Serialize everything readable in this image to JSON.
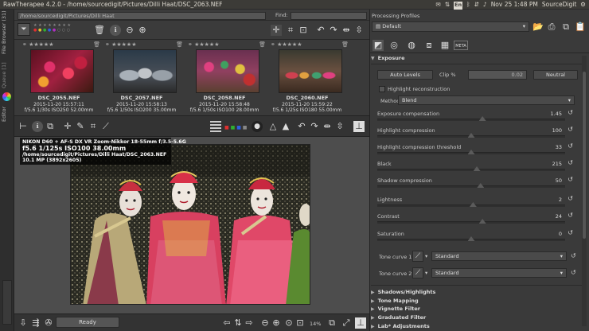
{
  "system_bar": {
    "window_title": "RawTherapee 4.2.0 - /home/sourcedigit/Pictures/Dilli Haat/DSC_2063.NEF",
    "keyboard": "En",
    "datetime": "Nov 25  1:48 PM",
    "user": "SourceDigit"
  },
  "side_tabs": {
    "file_browser": "File Browser (31)",
    "queue": "Queue [1]",
    "editor": "Editor"
  },
  "browser": {
    "path": "/home/sourcedigit/Pictures/Dilli Haat",
    "find_label": "Find:",
    "find_value": "",
    "thumbnails": [
      {
        "filename": "DSC_2055.NEF",
        "date": "2015-11-20 15:57:11",
        "exif": "f/5.6 1/30s ISO250 52.00mm",
        "stars": "★★★★★"
      },
      {
        "filename": "DSC_2057.NEF",
        "date": "2015-11-20 15:58:13",
        "exif": "f/5.6 1/50s ISO200 35.00mm",
        "stars": "★★★★★"
      },
      {
        "filename": "DSC_2058.NEF",
        "date": "2015-11-20 15:58:48",
        "exif": "f/5.6 1/50s ISO100 28.00mm",
        "stars": "★★★★★"
      },
      {
        "filename": "DSC_2060.NEF",
        "date": "2015-11-20 15:59:22",
        "exif": "f/5.6 1/25s ISO180 55.00mm",
        "stars": "★★★★★"
      }
    ]
  },
  "editor": {
    "info_camera": "NIKON D60 + AF-S DX VR Zoom-Nikkor 18-55mm f/3.5-5.6G",
    "info_exposure": "f5.6  1/125s  ISO100  38.00mm",
    "info_path": "/home/sourcedigit/Pictures/Dilli Haat/DSC_2063.NEF",
    "info_size": "10.1 MP (3892x2605)",
    "status": "Ready",
    "zoom": "14%"
  },
  "processing": {
    "title": "Processing Profiles",
    "profile": "Default",
    "exposure_title": "Exposure",
    "auto_levels_label": "Auto Levels",
    "clip_label": "Clip %",
    "clip_value": "0.02",
    "neutral_label": "Neutral",
    "highlight_reconstruction_label": "Highlight reconstruction",
    "method_label": "Method:",
    "method_value": "Blend",
    "sliders": [
      {
        "name": "Exposure compensation",
        "value": "1.45",
        "fraction": 0.56
      },
      {
        "name": "Highlight compression",
        "value": "100",
        "fraction": 0.5
      },
      {
        "name": "Highlight compression threshold",
        "value": "33",
        "fraction": 0.5
      },
      {
        "name": "Black",
        "value": "215",
        "fraction": 0.53
      },
      {
        "name": "Shadow compression",
        "value": "50",
        "fraction": 0.55
      },
      {
        "name": "Lightness",
        "value": "2",
        "fraction": 0.51
      },
      {
        "name": "Contrast",
        "value": "24",
        "fraction": 0.56
      },
      {
        "name": "Saturation",
        "value": "0",
        "fraction": 0.5
      }
    ],
    "tone_curve_1_label": "Tone curve 1:",
    "tone_curve_1_value": "Standard",
    "tone_curve_2_label": "Tone curve 2:",
    "tone_curve_2_value": "Standard",
    "sections": [
      "Shadows/Highlights",
      "Tone Mapping",
      "Vignette Filter",
      "Graduated Filter",
      "Lab* Adjustments"
    ]
  },
  "colors": {
    "panel_bg": "#3a3a3a",
    "toolbar_bg": "#333333",
    "accent_dot_red": "#e03030",
    "accent_dot_green": "#30b030",
    "accent_dot_blue": "#3060e0"
  }
}
